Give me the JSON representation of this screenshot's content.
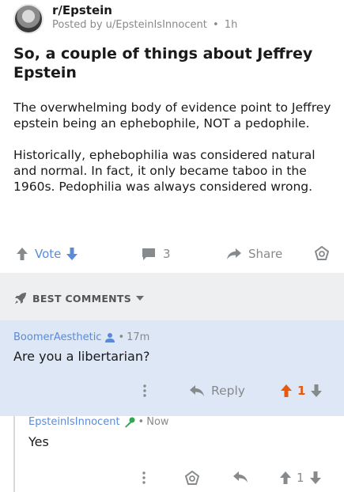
{
  "post": {
    "subreddit": "r/Epstein",
    "posted_by_prefix": "Posted by ",
    "author": "u/EpsteinIsInnocent",
    "separator": "•",
    "age": "1h",
    "title": "So, a couple of things about Jeffrey Epstein",
    "body_paragraphs": [
      "The overwhelming body of evidence point to Jeffrey epstein being an ephebophile, NOT a pedophile.",
      "Historically, ephebophilia was considered natural and normal. In fact, it only became taboo in the 1960s. Pedophilia was always considered wrong."
    ]
  },
  "actions": {
    "vote_label": "Vote",
    "comment_count": "3",
    "share_label": "Share"
  },
  "sort": {
    "label": "BEST COMMENTS"
  },
  "comments": [
    {
      "author": "BoomerAesthetic",
      "separator": "•",
      "age": "17m",
      "text": "Are you a libertarian?",
      "reply_label": "Reply",
      "score": "1"
    },
    {
      "author": "EpsteinIsInnocent",
      "separator": "•",
      "age": "Now",
      "text": "Yes",
      "score": "1"
    }
  ],
  "colors": {
    "accent_blue": "#5b8bd6",
    "upvote_orange": "#e8590c",
    "mod_green": "#2fa84f",
    "muted_gray": "#878a8c",
    "highlight_bg": "#dde7f5",
    "band_bg": "#edeff1"
  },
  "icons": {
    "upvote": "arrow-up-icon",
    "downvote": "arrow-down-icon",
    "comments": "speech-bubble-icon",
    "share": "share-arrow-icon",
    "award": "award-icon",
    "sort": "rocket-icon",
    "dropdown": "caret-down-icon",
    "user": "person-icon",
    "mod": "microphone-icon",
    "more": "more-vertical-icon",
    "reply": "reply-arrow-icon"
  }
}
